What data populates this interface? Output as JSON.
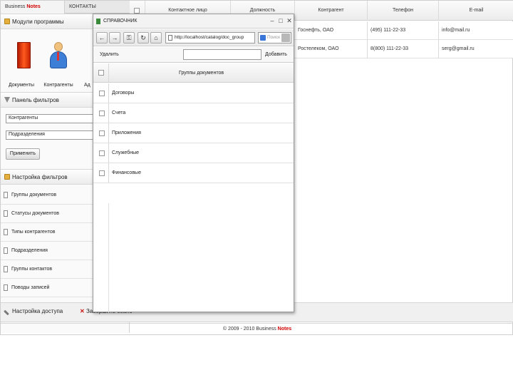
{
  "app": {
    "tabs": [
      {
        "prefix": "Business ",
        "brand": "Notes"
      },
      {
        "label": "КОНТАКТЫ"
      }
    ]
  },
  "left_panel": {
    "modules_title": "Модули программы",
    "modules": [
      {
        "label": "Документы",
        "icon": "document-icon"
      },
      {
        "label": "Контрагенты",
        "icon": "user-icon"
      },
      {
        "label": "Ад",
        "icon": "address-icon"
      }
    ],
    "filter_panel_title": "Панель фильтров",
    "filter_fields": [
      {
        "value": "Контрагенты"
      },
      {
        "value": "Подразделения"
      }
    ],
    "apply_label": "Применить",
    "filter_settings_title": "Настройка фильтров",
    "nav_items": [
      "Группы документов",
      "Статусы документов",
      "Типы контрагентов",
      "Подразделения",
      "Группы контактов",
      "Поводы записей"
    ]
  },
  "bottom_bar": {
    "access_label": "Настройка доступа",
    "exit_label": "Завершить сеанс"
  },
  "footer": {
    "text": "© 2009 - 2010 Business ",
    "brand": "Notes"
  },
  "contacts_grid": {
    "columns": [
      "Контактное лицо",
      "Должность",
      "Контрагент",
      "Телефон",
      "E-mail"
    ],
    "rows": [
      {
        "company": "Госнефть, ОАО",
        "phone": "(495) 111-22-33",
        "email": "info@mail.ru"
      },
      {
        "company": "Ростелеком, ОАО",
        "phone": "8(800) 111-22-33",
        "email": "serg@gmail.ru"
      }
    ]
  },
  "dialog": {
    "title": "СПРАВОЧНИК",
    "url": "http://localhost/catalog/doc_group",
    "search_placeholder": "Поиск",
    "delete_label": "Удалить",
    "add_label": "Добавить",
    "add_input_value": "",
    "column_header": "Группы документов",
    "rows": [
      "Договоры",
      "Счета",
      "Приложения",
      "Служебные",
      "Финансовые"
    ]
  }
}
